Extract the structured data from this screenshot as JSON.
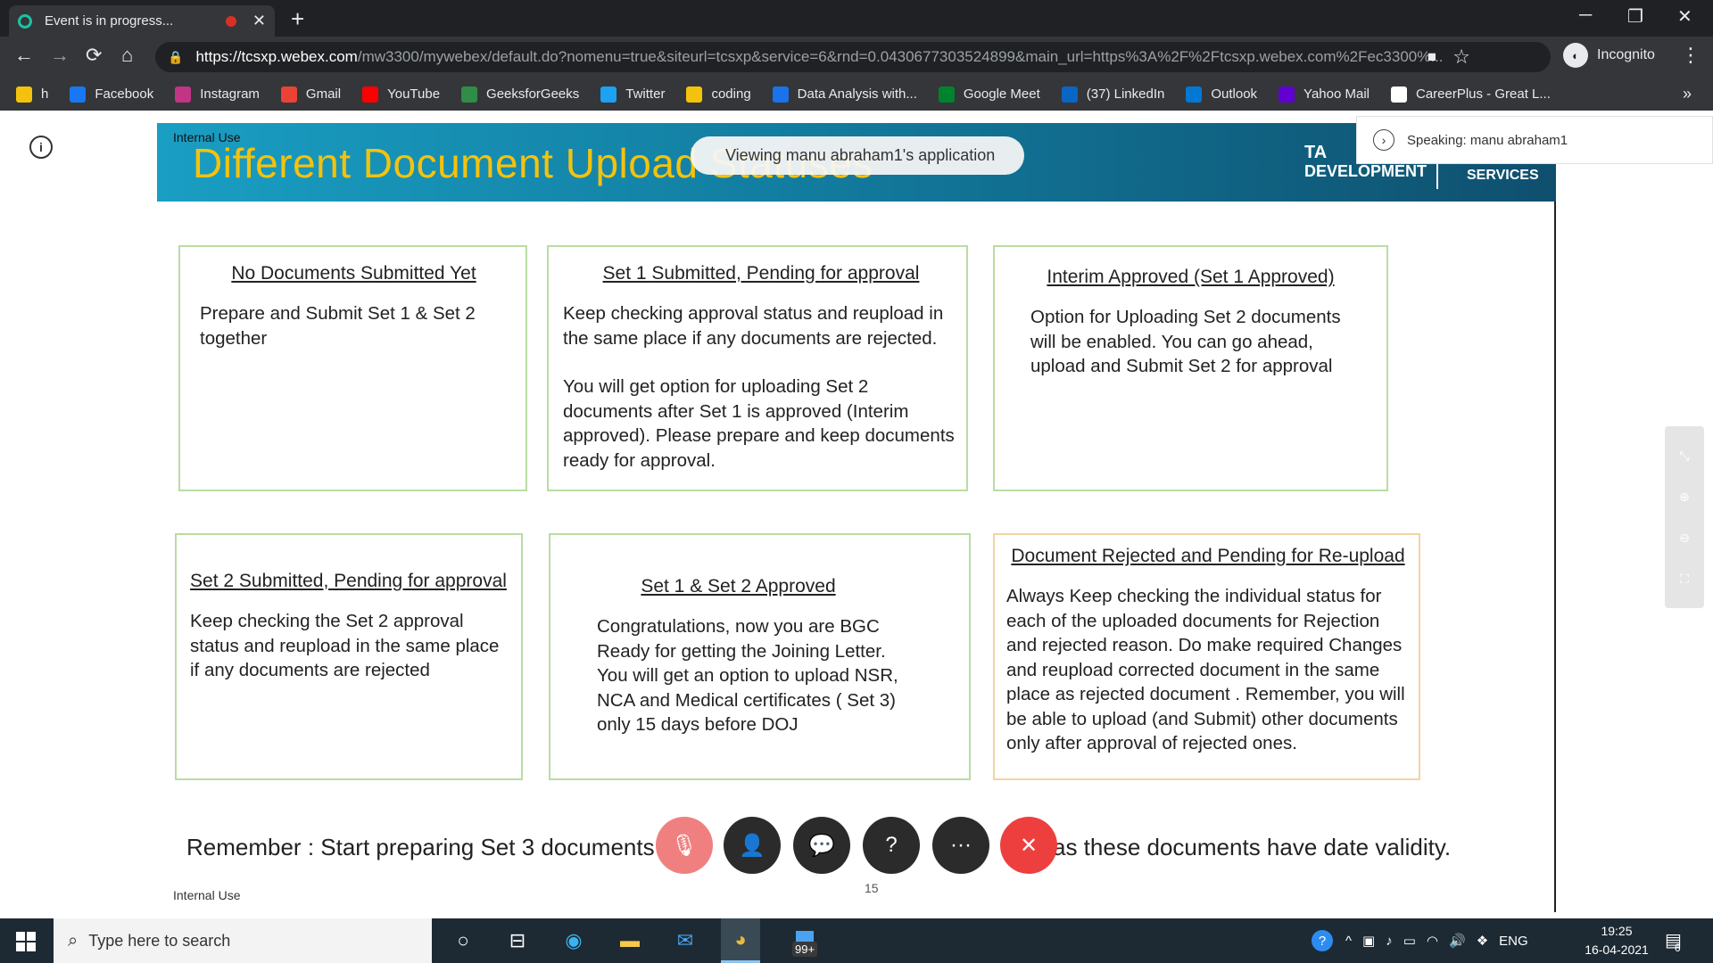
{
  "browser": {
    "tab_title": "Event is in progress...",
    "url_host": "https://tcsxp.webex.com",
    "url_rest": "/mw3300/mywebex/default.do?nomenu=true&siteurl=tcsxp&service=6&rnd=0.0430677303524899&main_url=https%3A%2F%2Ftcsxp.webex.com%2Fec3300%...",
    "incognito_label": "Incognito",
    "bookmarks": [
      {
        "label": "h",
        "icon": "folder-icon",
        "color": "#f4c20d"
      },
      {
        "label": "Facebook",
        "icon": "facebook-icon",
        "color": "#1877f2"
      },
      {
        "label": "Instagram",
        "icon": "instagram-icon",
        "color": "#c13584"
      },
      {
        "label": "Gmail",
        "icon": "gmail-icon",
        "color": "#ea4335"
      },
      {
        "label": "YouTube",
        "icon": "youtube-icon",
        "color": "#ff0000"
      },
      {
        "label": "GeeksforGeeks",
        "icon": "geeksforgeeks-icon",
        "color": "#2f8d46"
      },
      {
        "label": "Twitter",
        "icon": "twitter-icon",
        "color": "#1da1f2"
      },
      {
        "label": "coding",
        "icon": "folder-icon",
        "color": "#f4c20d"
      },
      {
        "label": "Data Analysis with...",
        "icon": "bookmark-icon",
        "color": "#1a73e8"
      },
      {
        "label": "Google Meet",
        "icon": "google-meet-icon",
        "color": "#00832d"
      },
      {
        "label": "(37) LinkedIn",
        "icon": "linkedin-icon",
        "color": "#0a66c2"
      },
      {
        "label": "Outlook",
        "icon": "outlook-icon",
        "color": "#0078d4"
      },
      {
        "label": "Yahoo Mail",
        "icon": "yahoo-mail-icon",
        "color": "#6001d2"
      },
      {
        "label": "CareerPlus - Great L...",
        "icon": "careerplus-icon",
        "color": "#ffffff"
      }
    ]
  },
  "meeting": {
    "viewing_banner": "Viewing manu abraham1's application",
    "speaking": "Speaking: manu abraham1",
    "controls": [
      {
        "name": "mute-button",
        "icon": "microphone-off-icon",
        "color": "#f08080"
      },
      {
        "name": "participants-button",
        "icon": "participants-icon",
        "color": "#2b2b2b"
      },
      {
        "name": "chat-button",
        "icon": "chat-icon",
        "color": "#2b2b2b"
      },
      {
        "name": "qa-button",
        "icon": "question-icon",
        "color": "#2b2b2b"
      },
      {
        "name": "more-button",
        "icon": "more-icon",
        "color": "#2b2b2b"
      },
      {
        "name": "leave-button",
        "icon": "close-icon",
        "color": "#ee3f3f"
      }
    ]
  },
  "slide": {
    "header_internal": "Internal Use",
    "title": "Different Document Upload Statuses",
    "brand_line1": "TA",
    "brand_line2": "DEVELOPMENT",
    "brand_line3": "SERVICES",
    "boxes": [
      {
        "title": "No Documents Submitted Yet",
        "body": "Prepare and Submit Set 1 & Set 2 together"
      },
      {
        "title": "Set 1 Submitted, Pending for approval",
        "body1": "Keep checking approval status and reupload in the same place if any documents are rejected.",
        "body2": "You will get option for uploading Set 2 documents after Set 1 is approved (Interim approved). Please prepare and keep documents ready for approval."
      },
      {
        "title": "Interim Approved (Set 1 Approved)",
        "body": "Option for Uploading Set 2 documents will be enabled. You can go ahead, upload and Submit Set 2 for approval"
      },
      {
        "title": "Set 2 Submitted, Pending for approval",
        "body": "Keep checking the Set 2 approval status and reupload in the same place if any documents are rejected"
      },
      {
        "title": "Set 1 & Set 2 Approved",
        "body": "Congratulations, now you are BGC Ready for getting the Joining Letter. You will get an option to upload NSR, NCA and Medical certificates ( Set 3) only 15 days before DOJ"
      },
      {
        "title": "Document Rejected and Pending for Re-upload",
        "body": "Always Keep checking the individual status for each of the uploaded documents for Rejection and rejected reason. Do make required Changes and reupload corrected document in the same place as rejected document . Remember, you will be able to upload (and Submit)  other documents only after approval of  rejected ones."
      }
    ],
    "remember_text": "Remember : Start preparing Set 3 documents only",
    "remember_tail": "as these documents have date validity.",
    "footer_internal": "Internal Use",
    "page_number": "15"
  },
  "taskbar": {
    "search_placeholder": "Type here to search",
    "badge": "99+",
    "language": "ENG",
    "time": "19:25",
    "date": "16-04-2021",
    "notification_count": "6"
  }
}
